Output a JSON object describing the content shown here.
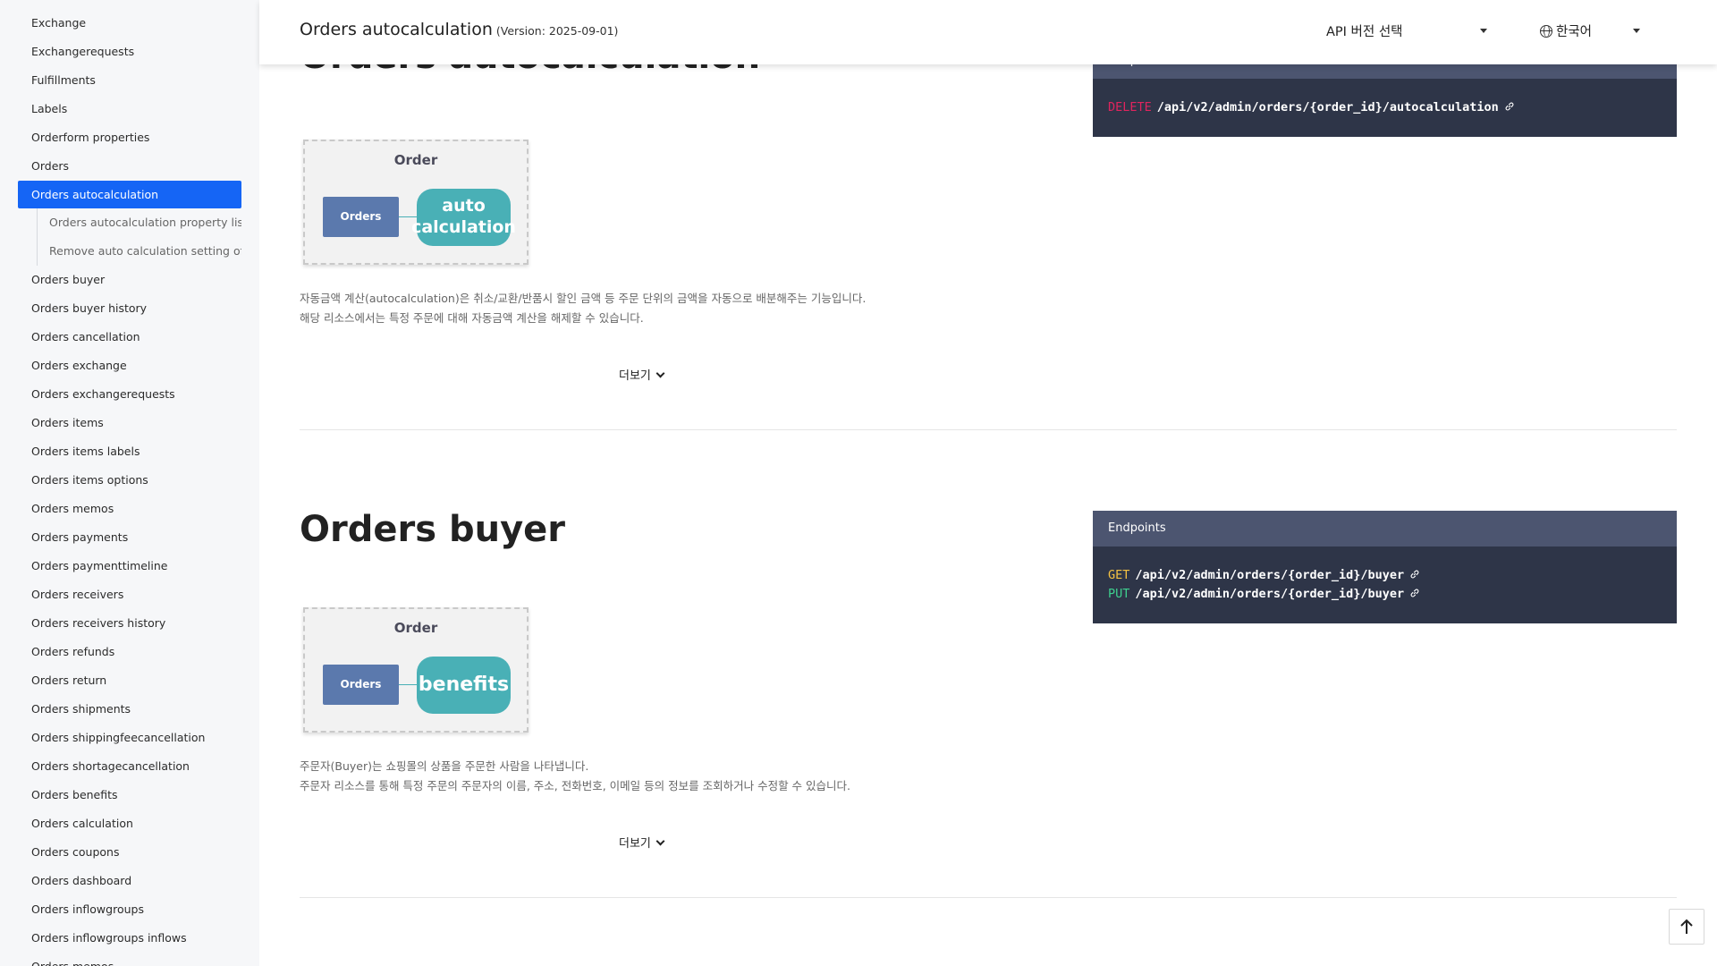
{
  "sidebar": {
    "items": [
      {
        "label": "Exchange"
      },
      {
        "label": "Exchangerequests"
      },
      {
        "label": "Fulfillments"
      },
      {
        "label": "Labels"
      },
      {
        "label": "Orderform properties"
      },
      {
        "label": "Orders"
      },
      {
        "label": "Orders autocalculation",
        "active": true
      },
      {
        "label": "Orders autocalculation property list",
        "sub": true
      },
      {
        "label": "Remove auto calculation setting of a",
        "sub": true
      },
      {
        "label": "Orders buyer"
      },
      {
        "label": "Orders buyer history"
      },
      {
        "label": "Orders cancellation"
      },
      {
        "label": "Orders exchange"
      },
      {
        "label": "Orders exchangerequests"
      },
      {
        "label": "Orders items"
      },
      {
        "label": "Orders items labels"
      },
      {
        "label": "Orders items options"
      },
      {
        "label": "Orders memos"
      },
      {
        "label": "Orders payments"
      },
      {
        "label": "Orders paymenttimeline"
      },
      {
        "label": "Orders receivers"
      },
      {
        "label": "Orders receivers history"
      },
      {
        "label": "Orders refunds"
      },
      {
        "label": "Orders return"
      },
      {
        "label": "Orders shipments"
      },
      {
        "label": "Orders shippingfeecancellation"
      },
      {
        "label": "Orders shortagecancellation"
      },
      {
        "label": "Orders benefits"
      },
      {
        "label": "Orders calculation"
      },
      {
        "label": "Orders coupons"
      },
      {
        "label": "Orders dashboard"
      },
      {
        "label": "Orders inflowgroups"
      },
      {
        "label": "Orders inflowgroups inflows"
      },
      {
        "label": "Orders memos"
      }
    ]
  },
  "header": {
    "title": "Orders autocalculation",
    "version": "(Version: 2025-09-01)",
    "version_select": "API 버전 선택",
    "language": "한국어"
  },
  "sections": [
    {
      "title": "Orders autocalculation",
      "diagram": {
        "title": "Order",
        "box": "Orders",
        "pill": "auto calculation"
      },
      "description": [
        "자동금액 계산(autocalculation)은 취소/교환/반품시 할인 금액 등 주문 단위의 금액을 자동으로 배분해주는 기능입니다.",
        "해당 리소스에서는 특정 주문에 대해 자동금액 계산을 해제할 수 있습니다."
      ],
      "more_label": "더보기",
      "endpoints_header": "Endpoints",
      "endpoints": [
        {
          "method": "DELETE",
          "method_color": "#e0245e",
          "path": "/api/v2/admin/orders/{order_id}/autocalculation"
        }
      ]
    },
    {
      "title": "Orders buyer",
      "diagram": {
        "title": "Order",
        "box": "Orders",
        "pill": "benefits"
      },
      "description": [
        "주문자(Buyer)는 쇼핑몰의 상품을 주문한 사람을 나타냅니다.",
        "주문자 리소스를 통해 특정 주문의 주문자의 이름, 주소, 전화번호, 이메일 등의 정보를 조회하거나 수정할 수 있습니다."
      ],
      "more_label": "더보기",
      "endpoints_header": "Endpoints",
      "endpoints": [
        {
          "method": "GET",
          "method_color": "#f5c242",
          "path": "/api/v2/admin/orders/{order_id}/buyer"
        },
        {
          "method": "PUT",
          "method_color": "#3ecf8e",
          "path": "/api/v2/admin/orders/{order_id}/buyer"
        }
      ]
    }
  ],
  "icons": {
    "scroll_top": "arrow-up-icon",
    "endpoint_link": "link-icon",
    "language": "globe-icon"
  }
}
